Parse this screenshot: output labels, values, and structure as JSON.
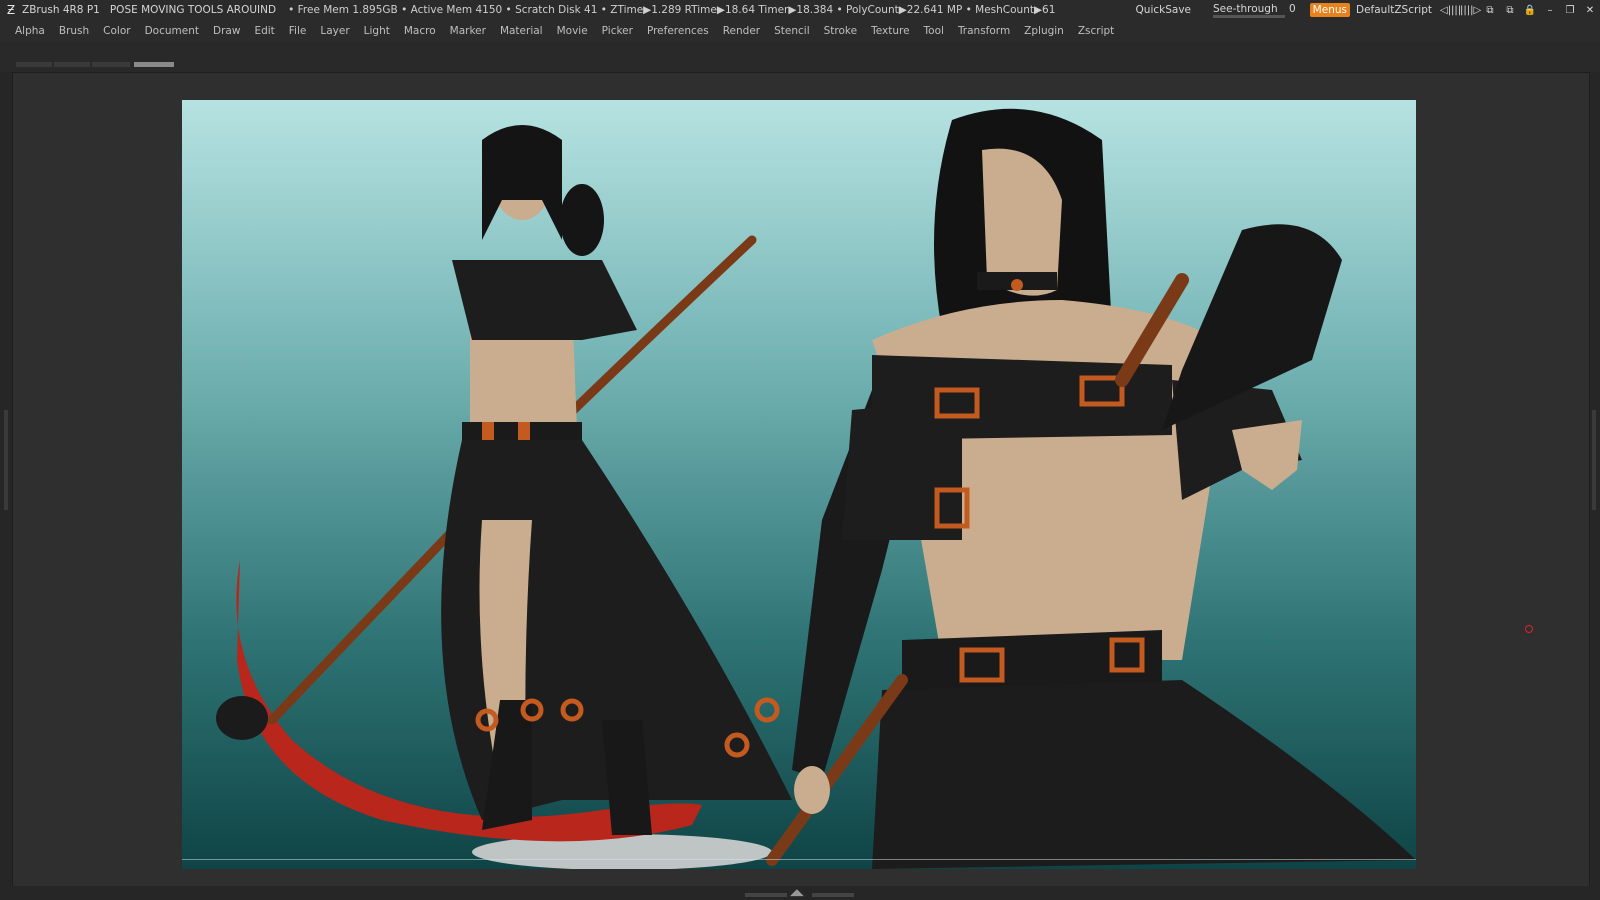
{
  "titlebar": {
    "app": "ZBrush 4R8 P1",
    "doc": "POSE MOVING TOOLS AROUIND",
    "stats": "• Free Mem 1.895GB • Active Mem 4150 • Scratch Disk 41 •  ZTime▶1.289 RTime▶18.64 Timer▶18.384 • PolyCount▶22.641 MP  • MeshCount▶61",
    "quicksave": "QuickSave",
    "seethrough_label": "See-through",
    "seethrough_value": "0",
    "seethrough_level": 0.0,
    "menus": "Menus",
    "script": "DefaultZScript",
    "icon_glyphs": [
      "◁||||",
      "||||▷",
      "⧉",
      "⧉",
      "🔒",
      "–",
      "❐",
      "✕"
    ]
  },
  "menubar": {
    "items": [
      "Alpha",
      "Brush",
      "Color",
      "Document",
      "Draw",
      "Edit",
      "File",
      "Layer",
      "Light",
      "Macro",
      "Marker",
      "Material",
      "Movie",
      "Picker",
      "Preferences",
      "Render",
      "Stencil",
      "Stroke",
      "Texture",
      "Tool",
      "Transform",
      "Zplugin",
      "Zscript"
    ]
  },
  "colors": {
    "accent": "#e8821c",
    "bg": "#262626",
    "canvas_top": "#b6e3e1",
    "canvas_bottom": "#0f4446",
    "model_black": "#1d1d1d",
    "model_skin": "#c9ad8e",
    "model_orange": "#c35a20",
    "scythe_red": "#b8261c"
  }
}
